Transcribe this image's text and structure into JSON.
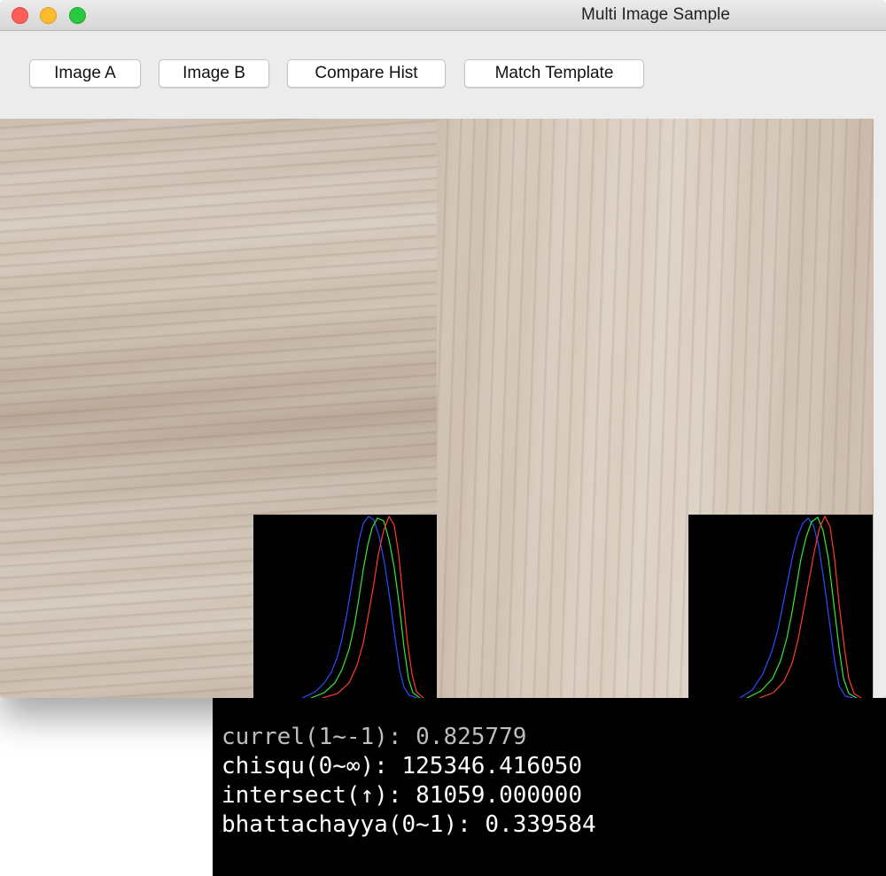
{
  "window": {
    "title": "Multi Image Sample"
  },
  "toolbar": {
    "buttons": [
      {
        "label": "Image A"
      },
      {
        "label": "Image B"
      },
      {
        "label": "Compare Hist"
      },
      {
        "label": "Match Template"
      }
    ]
  },
  "images": {
    "image_a": {
      "content": "light wood grain, horizontal"
    },
    "image_b": {
      "content": "light wood grain, vertical"
    }
  },
  "histograms": {
    "channel_colors": {
      "blue": "#2a4dff",
      "green": "#34e834",
      "red": "#ff3b2f"
    }
  },
  "results": {
    "lines": [
      "currel(1~-1): 0.825779",
      "chisqu(0~∞): 125346.416050",
      "intersect(↑): 81059.000000",
      "bhattachayya(0~1): 0.339584"
    ]
  }
}
